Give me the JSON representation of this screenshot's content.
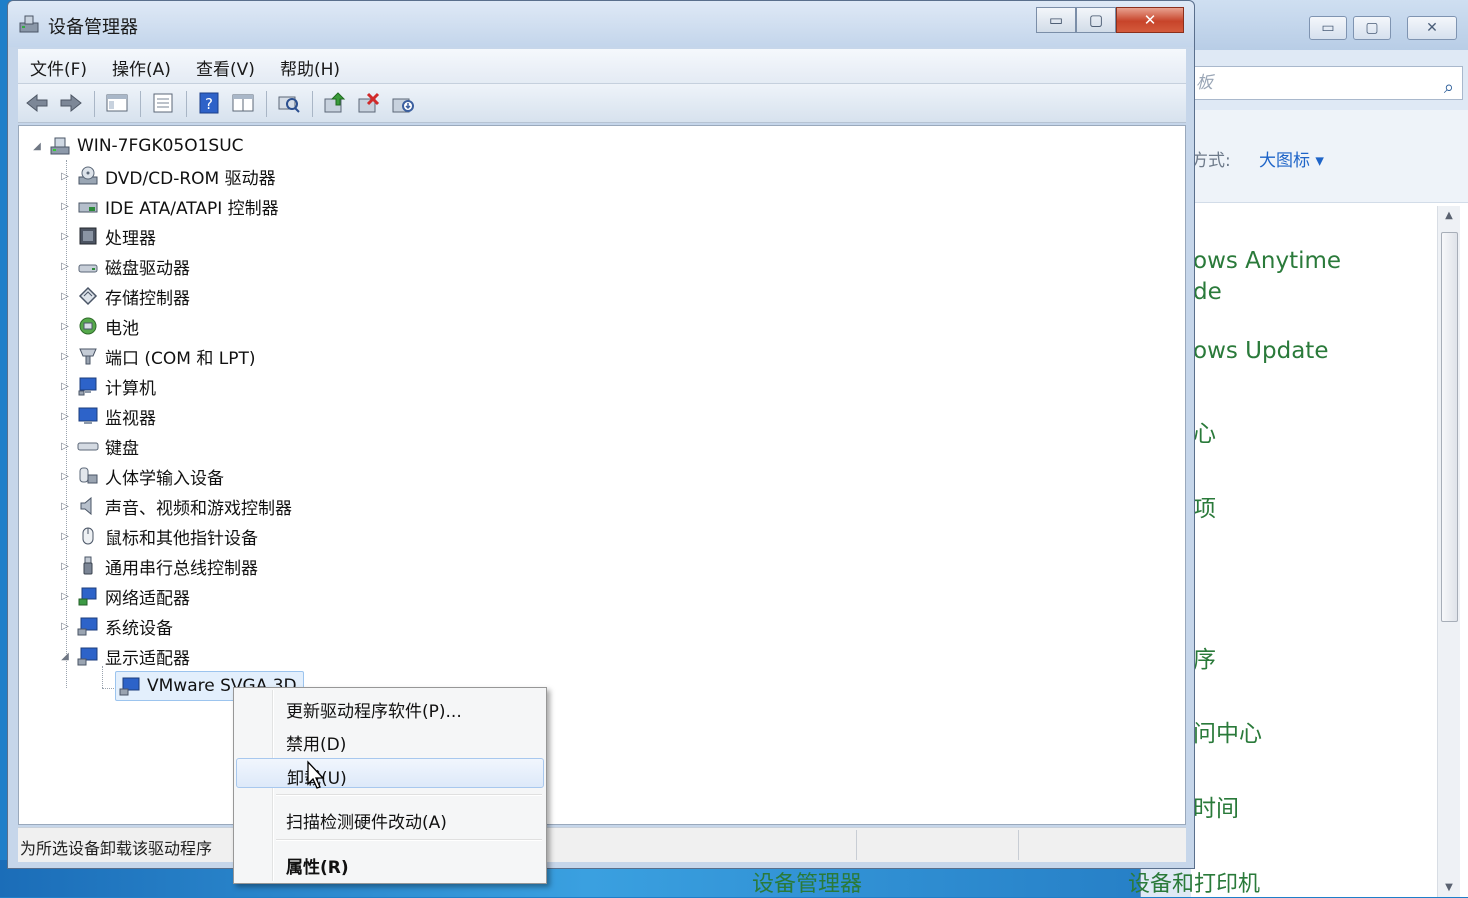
{
  "window": {
    "title": "设备管理器",
    "minimize_glyph": "▭",
    "maximize_glyph": "▢",
    "close_glyph": "✕"
  },
  "menubar": [
    {
      "label": "文件(F)"
    },
    {
      "label": "操作(A)"
    },
    {
      "label": "查看(V)"
    },
    {
      "label": "帮助(H)"
    }
  ],
  "toolbar": {
    "icons": [
      "back-icon",
      "forward-icon",
      "show-hide-tree-icon",
      "properties-icon",
      "help-icon",
      "view-icon",
      "scan-hardware-icon",
      "update-driver-icon",
      "uninstall-icon",
      "disable-icon"
    ]
  },
  "tree": {
    "root": "WIN-7FGK05O1SUC",
    "categories": [
      {
        "label": "DVD/CD-ROM 驱动器"
      },
      {
        "label": "IDE ATA/ATAPI 控制器"
      },
      {
        "label": "处理器"
      },
      {
        "label": "磁盘驱动器"
      },
      {
        "label": "存储控制器"
      },
      {
        "label": "电池"
      },
      {
        "label": "端口 (COM 和 LPT)"
      },
      {
        "label": "计算机"
      },
      {
        "label": "监视器"
      },
      {
        "label": "键盘"
      },
      {
        "label": "人体学输入设备"
      },
      {
        "label": "声音、视频和游戏控制器"
      },
      {
        "label": "鼠标和其他指针设备"
      },
      {
        "label": "通用串行总线控制器"
      },
      {
        "label": "网络适配器"
      },
      {
        "label": "系统设备"
      },
      {
        "label": "显示适配器"
      }
    ],
    "selected_child": "VMware SVGA 3D"
  },
  "status": {
    "text": "为所选设备卸载该驱动程序"
  },
  "context_menu": {
    "items": [
      {
        "label": "更新驱动程序软件(P)..."
      },
      {
        "label": "禁用(D)"
      },
      {
        "label": "卸载(U)"
      },
      {
        "label": "扫描检测硬件改动(A)"
      },
      {
        "label": "属性(R)"
      }
    ]
  },
  "background_window": {
    "search_placeholder": "板",
    "view_mode_label": "方式:",
    "view_mode_value": "大图标 ▾",
    "items": [
      "ows Anytime",
      "de",
      "ows Update",
      "心",
      "项",
      "序",
      "问中心",
      "时间"
    ],
    "bottom_items": [
      "设备管理器",
      "设备和打印机"
    ]
  },
  "colors": {
    "accent_link": "#1e64c8",
    "cp_item_green": "#2a7a3a",
    "selection_bg": "#e3effc"
  }
}
